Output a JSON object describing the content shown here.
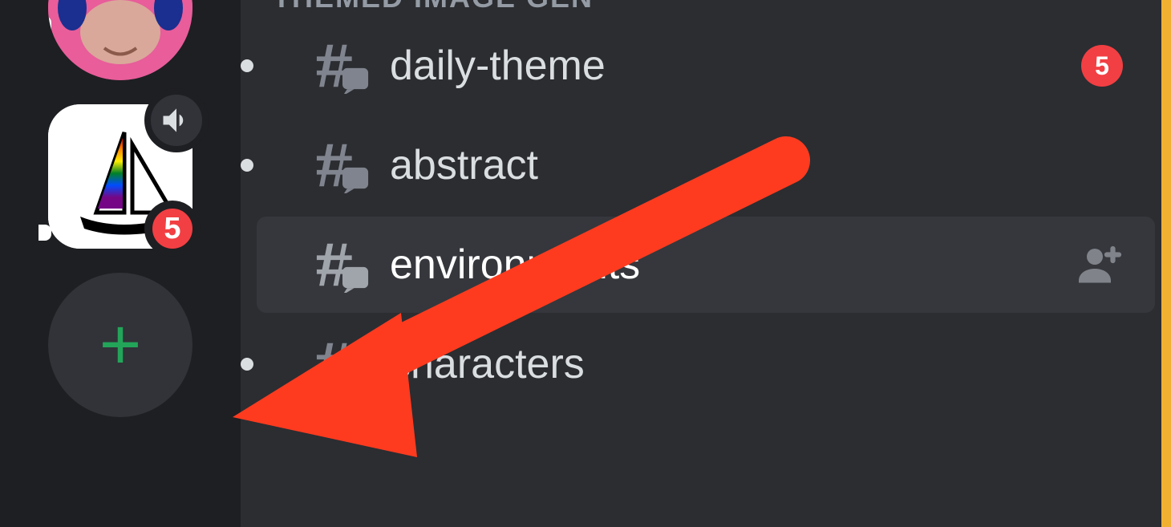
{
  "servers": {
    "avatar1_alt": "server-avatar-vr",
    "avatar2_alt": "server-avatar-sail",
    "avatar2_badge": "5",
    "add_label": "+"
  },
  "category": {
    "name": "THEMED IMAGE GEN"
  },
  "channels": [
    {
      "name": "daily-theme",
      "unread": true,
      "mentions": "5",
      "selected": false
    },
    {
      "name": "abstract",
      "unread": true,
      "mentions": null,
      "selected": false
    },
    {
      "name": "environments",
      "unread": false,
      "mentions": null,
      "selected": true
    },
    {
      "name": "characters",
      "unread": true,
      "mentions": null,
      "selected": false
    }
  ],
  "colors": {
    "accent_red": "#f23f43",
    "accent_green": "#23a559",
    "accent_yellow": "#f0b132",
    "bg_dark": "#1e1f22",
    "bg_mid": "#2b2d31"
  }
}
